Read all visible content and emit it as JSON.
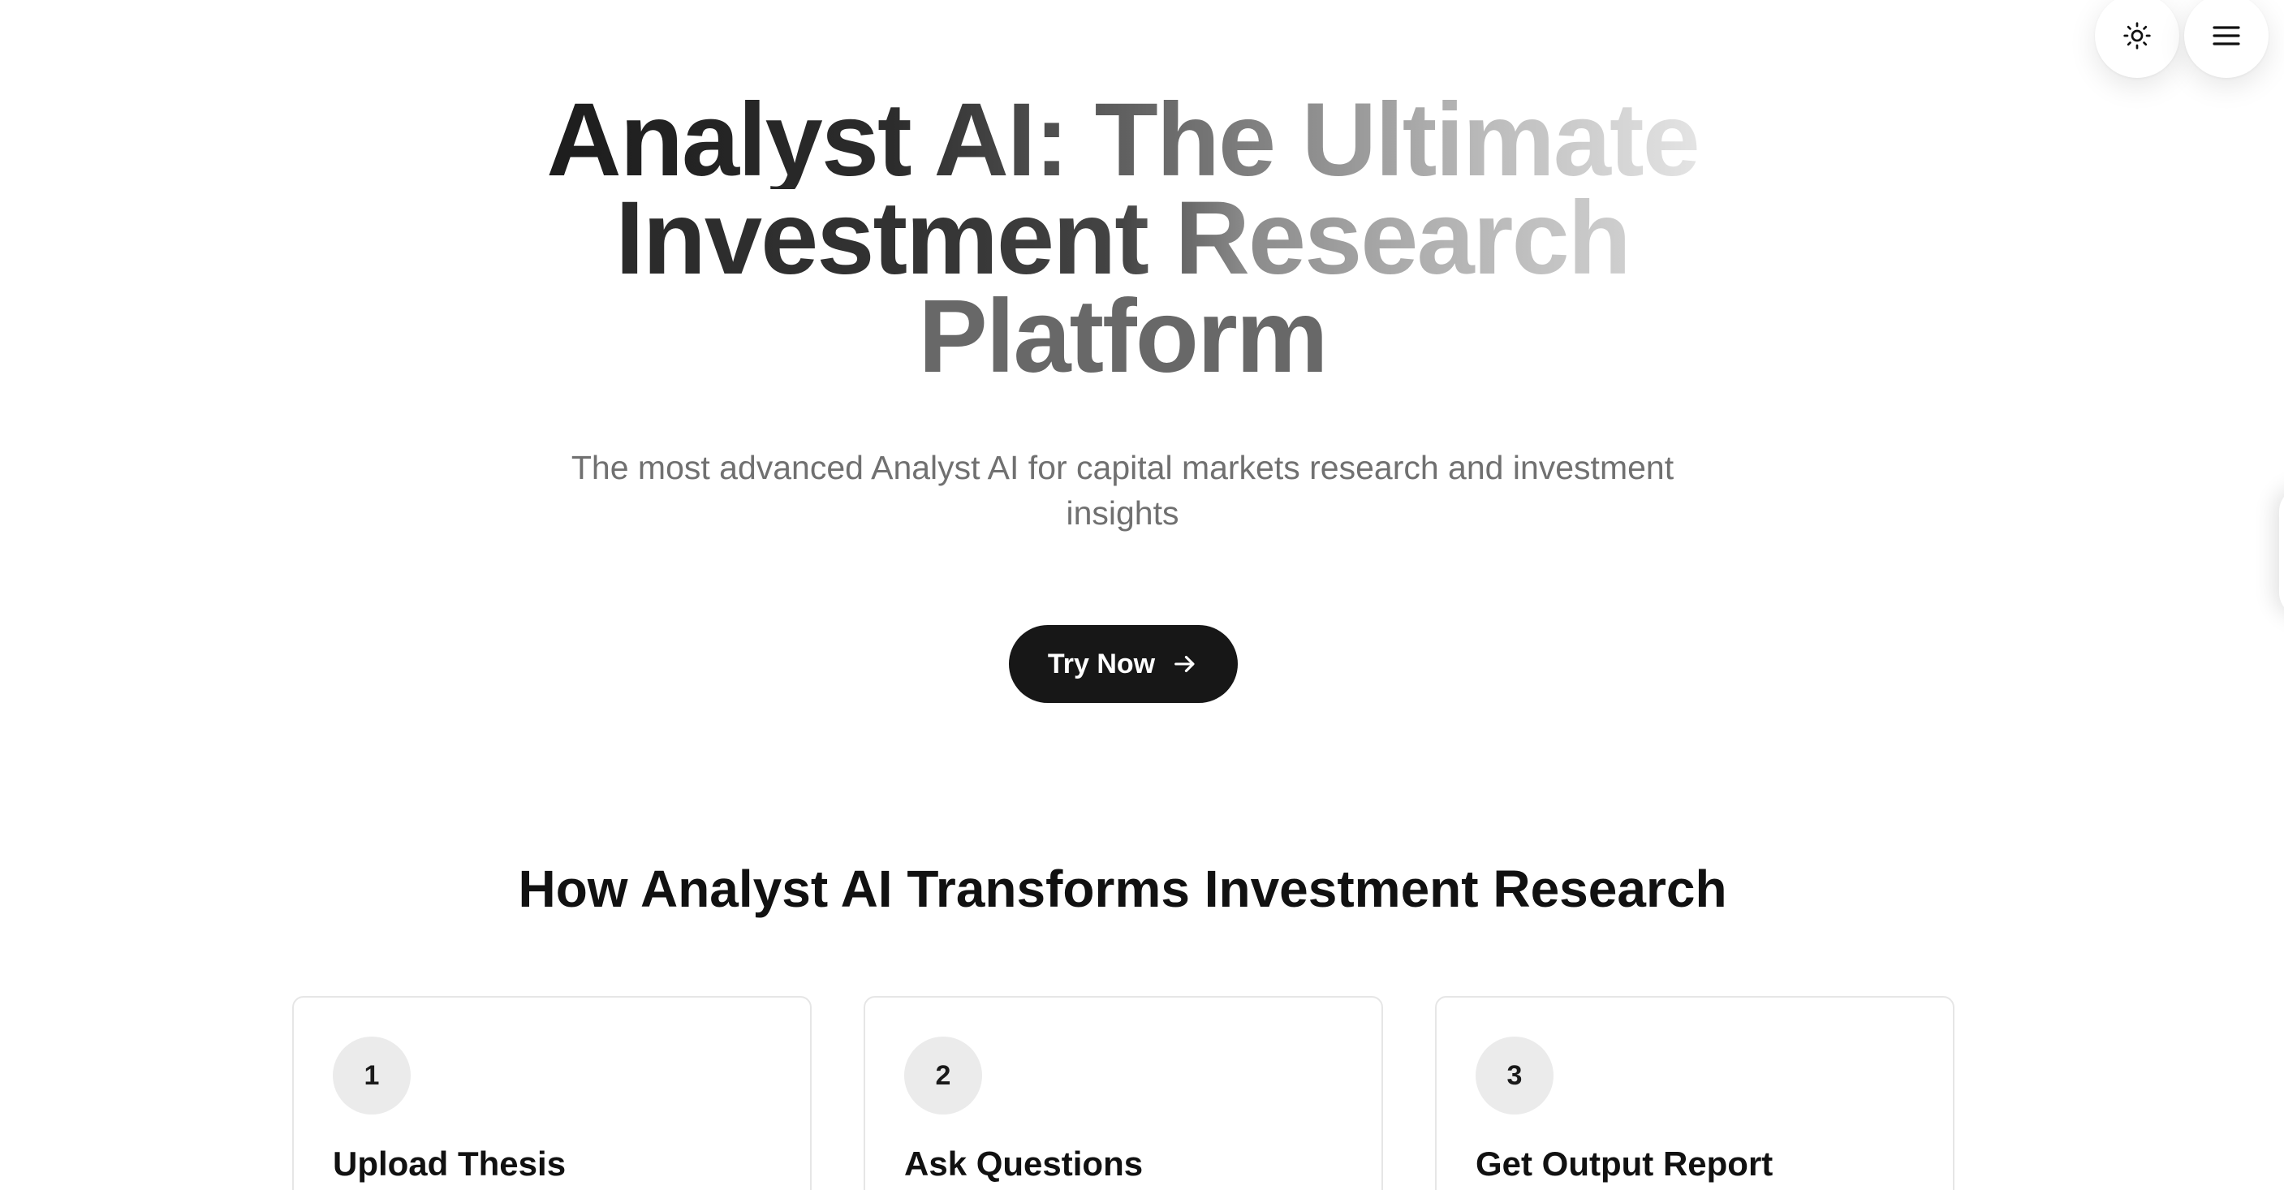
{
  "header": {
    "theme_toggle_icon": "sun-icon",
    "menu_icon": "hamburger-menu-icon"
  },
  "hero": {
    "title_line1": "Analyst AI: The Ultimate",
    "title_line2": "Investment Research",
    "title_line3": "Platform",
    "subtitle": "The most advanced Analyst AI for capital markets research and investment insights",
    "cta_label": "Try Now",
    "cta_icon": "arrow-right-icon"
  },
  "how_it_works": {
    "title": "How Analyst AI Transforms Investment Research",
    "steps": [
      {
        "number": "1",
        "title": "Upload Thesis"
      },
      {
        "number": "2",
        "title": "Ask Questions"
      },
      {
        "number": "3",
        "title": "Get Output Report"
      }
    ]
  },
  "colors": {
    "cta_background": "#171717",
    "cta_text": "#ffffff",
    "step_badge": "#ebebeb",
    "subtitle_text": "#707070",
    "card_border": "#e6e6e6"
  }
}
